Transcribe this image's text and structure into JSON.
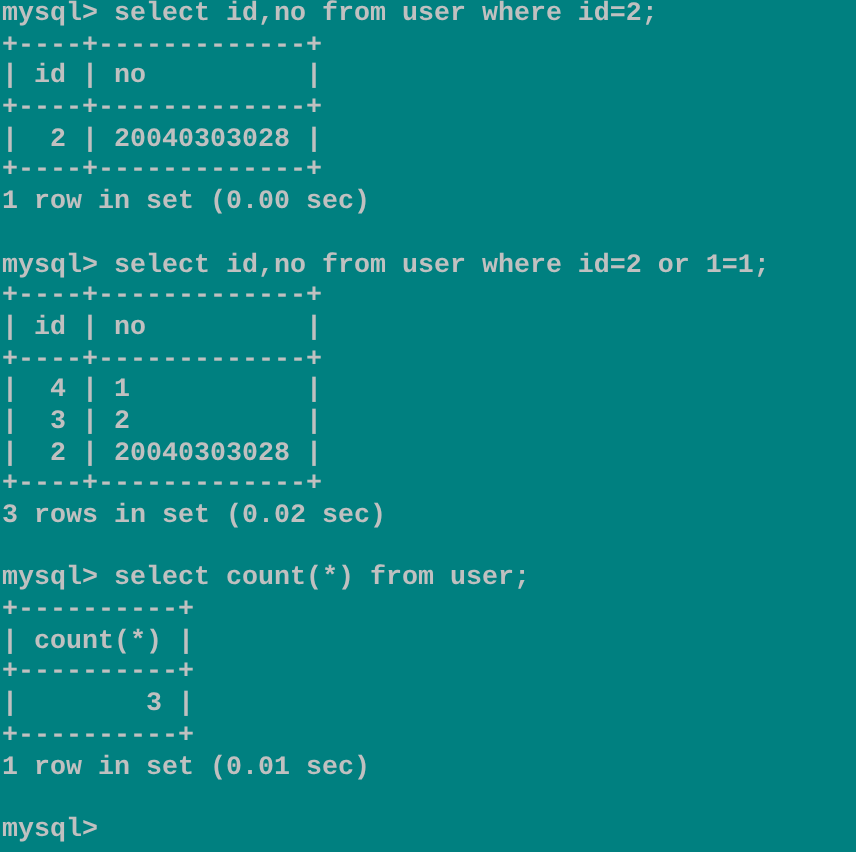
{
  "terminal": {
    "blocks": [
      {
        "command": "mysql> select id,no from user where id=2;",
        "output": [
          "+----+-------------+",
          "| id | no          |",
          "+----+-------------+",
          "|  2 | 20040303028 |",
          "+----+-------------+",
          "1 row in set (0.00 sec)"
        ]
      },
      {
        "command": "mysql> select id,no from user where id=2 or 1=1;",
        "output": [
          "+----+-------------+",
          "| id | no          |",
          "+----+-------------+",
          "|  4 | 1           |",
          "|  3 | 2           |",
          "|  2 | 20040303028 |",
          "+----+-------------+",
          "3 rows in set (0.02 sec)"
        ]
      },
      {
        "command": "mysql> select count(*) from user;",
        "output": [
          "+----------+",
          "| count(*) |",
          "+----------+",
          "|        3 |",
          "+----------+",
          "1 row in set (0.01 sec)"
        ]
      },
      {
        "command": "mysql>"
      }
    ]
  }
}
